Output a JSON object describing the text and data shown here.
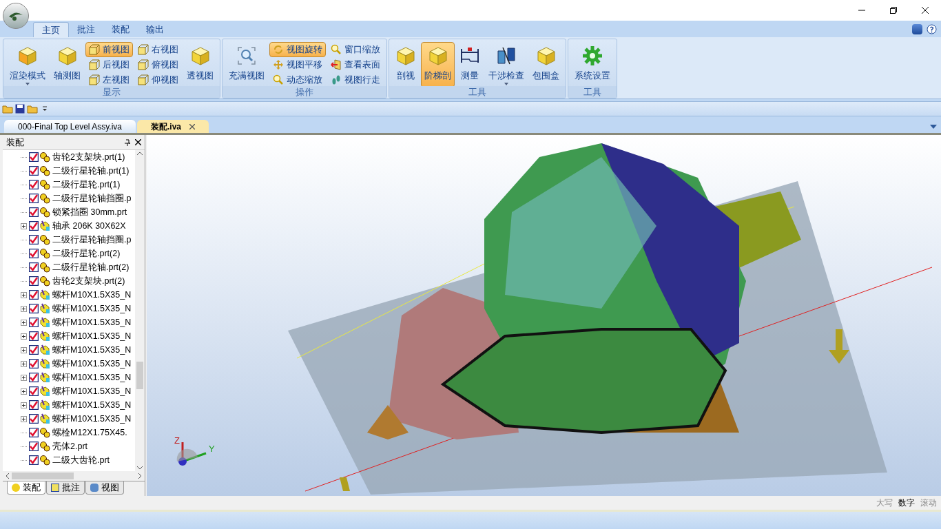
{
  "ribbon": {
    "tabs": [
      {
        "label": "主页",
        "selected": true
      },
      {
        "label": "批注",
        "selected": false
      },
      {
        "label": "装配",
        "selected": false
      },
      {
        "label": "输出",
        "selected": false
      }
    ],
    "groups": [
      {
        "title": "显示",
        "large_before": [
          {
            "label": "渲染模式",
            "selected": false,
            "dropdown": true
          },
          {
            "label": "轴测图",
            "selected": false,
            "dropdown": false
          }
        ],
        "small": [
          {
            "label": "前视图",
            "selected": true
          },
          {
            "label": "后视图",
            "selected": false
          },
          {
            "label": "左视图",
            "selected": false
          },
          {
            "label": "右视图",
            "selected": false
          },
          {
            "label": "俯视图",
            "selected": false
          },
          {
            "label": "仰视图",
            "selected": false
          }
        ],
        "large_after": [
          {
            "label": "透视图",
            "selected": false,
            "dropdown": false
          }
        ]
      },
      {
        "title": "操作",
        "large_before": [
          {
            "label": "充满视图",
            "selected": false,
            "dropdown": false
          }
        ],
        "small": [
          {
            "label": "视图旋转",
            "selected": true
          },
          {
            "label": "视图平移",
            "selected": false
          },
          {
            "label": "动态缩放",
            "selected": false
          },
          {
            "label": "窗口缩放",
            "selected": false
          },
          {
            "label": "查看表面",
            "selected": false
          },
          {
            "label": "视图行走",
            "selected": false
          }
        ]
      },
      {
        "title": "工具",
        "large_before": [
          {
            "label": "剖视",
            "selected": false,
            "dropdown": false
          },
          {
            "label": "阶梯剖",
            "selected": true,
            "dropdown": false
          },
          {
            "label": "测量",
            "selected": false,
            "dropdown": false
          },
          {
            "label": "干涉检查",
            "selected": false,
            "dropdown": true
          },
          {
            "label": "包围盒",
            "selected": false,
            "dropdown": false
          }
        ]
      },
      {
        "title": "工具",
        "large_before": [
          {
            "label": "系统设置",
            "selected": false,
            "dropdown": false
          }
        ]
      }
    ]
  },
  "documents": [
    {
      "label": "000-Final Top Level Assy.iva",
      "selected": false
    },
    {
      "label": "装配.iva",
      "selected": true
    }
  ],
  "panel": {
    "title": "装配",
    "items": [
      {
        "label": "齿轮2支架块.prt(1)",
        "kind": "part",
        "checked": true
      },
      {
        "label": "二级行星轮轴.prt(1)",
        "kind": "part",
        "checked": true
      },
      {
        "label": "二级行星轮.prt(1)",
        "kind": "part",
        "checked": true
      },
      {
        "label": "二级行星轮轴挡圈.p",
        "kind": "part",
        "checked": true
      },
      {
        "label": "锁紧挡圈 30mm.prt",
        "kind": "part",
        "checked": true
      },
      {
        "label": "轴承 206K 30X62X",
        "kind": "assembly",
        "checked": true
      },
      {
        "label": "二级行星轮轴挡圈.p",
        "kind": "part",
        "checked": true
      },
      {
        "label": "二级行星轮.prt(2)",
        "kind": "part",
        "checked": true
      },
      {
        "label": "二级行星轮轴.prt(2)",
        "kind": "part",
        "checked": true
      },
      {
        "label": "齿轮2支架块.prt(2)",
        "kind": "part",
        "checked": true
      },
      {
        "label": "螺杆M10X1.5X35_N",
        "kind": "assembly",
        "checked": true
      },
      {
        "label": "螺杆M10X1.5X35_N",
        "kind": "assembly",
        "checked": true
      },
      {
        "label": "螺杆M10X1.5X35_N",
        "kind": "assembly",
        "checked": true
      },
      {
        "label": "螺杆M10X1.5X35_N",
        "kind": "assembly",
        "checked": true
      },
      {
        "label": "螺杆M10X1.5X35_N",
        "kind": "assembly",
        "checked": true
      },
      {
        "label": "螺杆M10X1.5X35_N",
        "kind": "assembly",
        "checked": true
      },
      {
        "label": "螺杆M10X1.5X35_N",
        "kind": "assembly",
        "checked": true
      },
      {
        "label": "螺杆M10X1.5X35_N",
        "kind": "assembly",
        "checked": true
      },
      {
        "label": "螺杆M10X1.5X35_N",
        "kind": "assembly",
        "checked": true
      },
      {
        "label": "螺杆M10X1.5X35_N",
        "kind": "assembly",
        "checked": true
      },
      {
        "label": "螺栓M12X1.75X45.",
        "kind": "part",
        "checked": true
      },
      {
        "label": "壳体2.prt",
        "kind": "part",
        "checked": true
      },
      {
        "label": "二级大齿轮.prt",
        "kind": "part",
        "checked": true
      }
    ],
    "tabs": [
      {
        "label": "装配",
        "selected": true
      },
      {
        "label": "批注",
        "selected": false
      },
      {
        "label": "视图",
        "selected": false
      }
    ]
  },
  "viewport": {
    "axis_labels": [
      "Z",
      "Y"
    ]
  },
  "status_bar": [
    {
      "label": "大写",
      "on": false
    },
    {
      "label": "数字",
      "on": true
    },
    {
      "label": "滚动",
      "on": false
    }
  ]
}
